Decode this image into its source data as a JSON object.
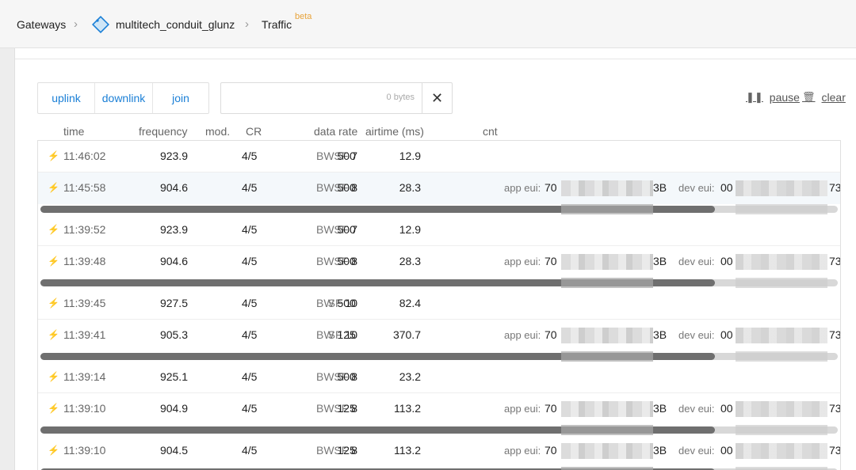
{
  "breadcrumb": {
    "gateways": "Gateways",
    "gateway": "multitech_conduit_glunz",
    "traffic": "Traffic",
    "beta": "beta",
    "separator": ">"
  },
  "tabs": [
    "uplink",
    "downlink",
    "join"
  ],
  "filter": {
    "bytes_placeholder": "0 bytes",
    "clear_symbol": "✕"
  },
  "actions": {
    "pause": "pause",
    "clear": "clear"
  },
  "columns": {
    "time": "time",
    "frequency": "frequency",
    "mod": "mod.",
    "cr": "CR",
    "data_rate": "data rate",
    "airtime": "airtime (ms)",
    "cnt": "cnt"
  },
  "labels": {
    "sf": "SF",
    "bw": "BW",
    "app_eui": "app eui:",
    "dev_eui": "dev eui:"
  },
  "rows": [
    {
      "dir": "up",
      "time": "11:46:02",
      "freq": "923.9",
      "cr": "4/5",
      "sf": "7",
      "bw": "500",
      "air": "12.9"
    },
    {
      "dir": "down",
      "time": "11:45:58",
      "freq": "904.6",
      "cr": "4/5",
      "sf": "8",
      "bw": "500",
      "air": "28.3",
      "app_eui_start": "70",
      "app_eui_end": "3B",
      "dev_eui_start": "00",
      "dev_eui_end": "73"
    },
    {
      "dir": "up",
      "time": "11:39:52",
      "freq": "923.9",
      "cr": "4/5",
      "sf": "7",
      "bw": "500",
      "air": "12.9"
    },
    {
      "dir": "down",
      "time": "11:39:48",
      "freq": "904.6",
      "cr": "4/5",
      "sf": "8",
      "bw": "500",
      "air": "28.3",
      "app_eui_start": "70",
      "app_eui_end": "3B",
      "dev_eui_start": "00",
      "dev_eui_end": "73"
    },
    {
      "dir": "up",
      "time": "11:39:45",
      "freq": "927.5",
      "cr": "4/5",
      "sf": "10",
      "bw": "500",
      "air": "82.4"
    },
    {
      "dir": "down",
      "time": "11:39:41",
      "freq": "905.3",
      "cr": "4/5",
      "sf": "10",
      "bw": "125",
      "air": "370.7",
      "app_eui_start": "70",
      "app_eui_end": "3B",
      "dev_eui_start": "00",
      "dev_eui_end": "73"
    },
    {
      "dir": "up",
      "time": "11:39:14",
      "freq": "925.1",
      "cr": "4/5",
      "sf": "8",
      "bw": "500",
      "air": "23.2"
    },
    {
      "dir": "down",
      "time": "11:39:10",
      "freq": "904.9",
      "cr": "4/5",
      "sf": "8",
      "bw": "125",
      "air": "113.2",
      "app_eui_start": "70",
      "app_eui_end": "3B",
      "dev_eui_start": "00",
      "dev_eui_end": "73"
    },
    {
      "dir": "down",
      "time": "11:39:10",
      "freq": "904.5",
      "cr": "4/5",
      "sf": "8",
      "bw": "125",
      "air": "113.2",
      "app_eui_start": "70",
      "app_eui_end": "3B",
      "dev_eui_start": "00",
      "dev_eui_end": "73"
    }
  ],
  "selected_row": 1
}
